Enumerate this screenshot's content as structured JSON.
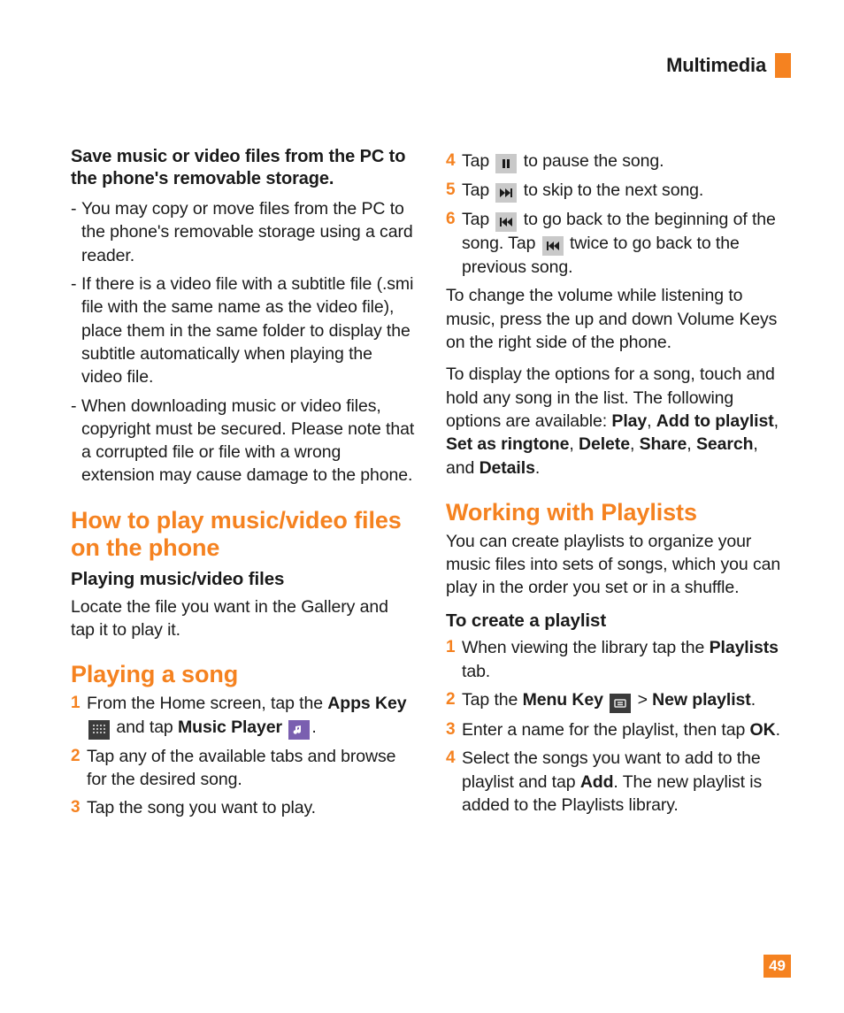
{
  "header": {
    "title": "Multimedia"
  },
  "page_number": "49",
  "left": {
    "intro_bold": "Save music or video files from the PC to the phone's removable storage.",
    "dashes": [
      "You may copy or move files from the PC to the phone's removable storage using a card reader.",
      "If there is a video file with a subtitle file (.smi file with the same name as the video file), place them in the same folder to display the subtitle automatically when playing the video file.",
      "When downloading music or video files, copyright must be secured. Please note that a corrupted file or file with a wrong extension may cause damage to the phone."
    ],
    "h1": "How to play music/video files on the phone",
    "sub1": "Playing music/video files",
    "p1": "Locate the file you want in the Gallery and tap it to play it.",
    "h2": "Playing a song",
    "steps": {
      "s1_a": "From the Home screen, tap the ",
      "s1_b": "Apps Key",
      "s1_c": " and tap ",
      "s1_d": "Music Player",
      "s1_e": ".",
      "s2": "Tap any of the available tabs and browse for the desired song.",
      "s3": "Tap the song you want to play."
    }
  },
  "right": {
    "steps456": {
      "s4_a": "Tap ",
      "s4_b": " to pause the song.",
      "s5_a": "Tap ",
      "s5_b": " to skip to the next song.",
      "s6_a": "Tap ",
      "s6_b": " to go back to the beginning of the song. Tap ",
      "s6_c": " twice to go back to the previous song."
    },
    "p_volume": "To change the volume while listening to music, press the up and down Volume Keys on the right side of the phone.",
    "p_options_a": "To display the options for a song, touch and hold any song in the list. The following options are available: ",
    "opts": [
      "Play",
      "Add to playlist",
      "Set as ringtone",
      "Delete",
      "Share",
      "Search",
      "Details"
    ],
    "p_options_and": ", and ",
    "h3": "Working with Playlists",
    "p_playlists": "You can create playlists to organize your music files into sets of songs, which you can play in the order you set or in a shuffle.",
    "sub2": "To create a playlist",
    "psteps": {
      "p1_a": "When viewing the library tap the ",
      "p1_b": "Playlists",
      "p1_c": " tab.",
      "p2_a": "Tap the ",
      "p2_b": "Menu Key",
      "p2_c": " > ",
      "p2_d": "New playlist",
      "p2_e": ".",
      "p3_a": "Enter a name for the playlist, then tap ",
      "p3_b": "OK",
      "p3_c": ".",
      "p4_a": "Select the songs you want to add to the playlist and tap ",
      "p4_b": "Add",
      "p4_c": ". The new playlist is added to the Playlists library."
    }
  }
}
